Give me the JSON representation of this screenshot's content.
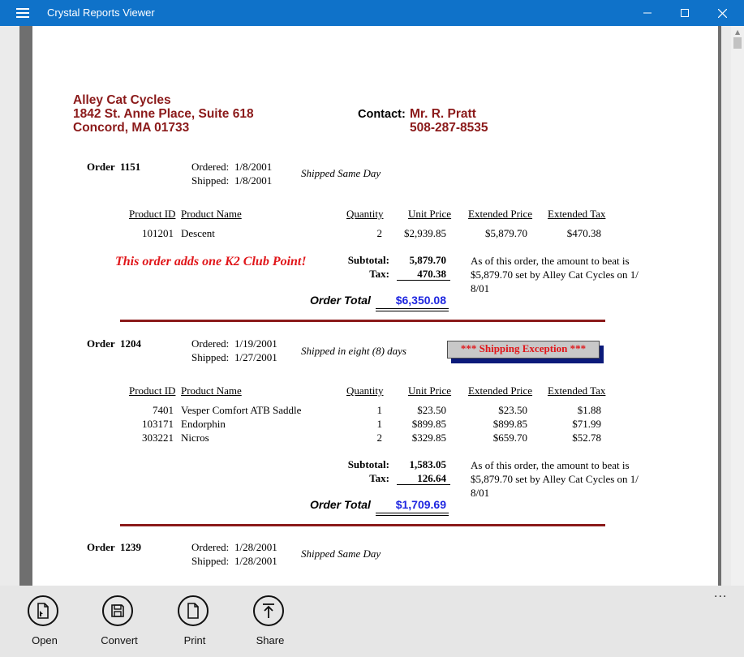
{
  "window": {
    "title": "Crystal Reports Viewer"
  },
  "company": {
    "name": "Alley Cat Cycles",
    "address1": "1842 St. Anne Place, Suite 618",
    "address2": "Concord, MA  01733",
    "contact_label": "Contact:",
    "contact_name": "Mr. R. Pratt",
    "contact_phone": "508-287-8535"
  },
  "labels": {
    "order": "Order",
    "ordered": "Ordered:",
    "shipped": "Shipped:",
    "product_id": "Product ID",
    "product_name": "Product Name",
    "quantity": "Quantity",
    "unit_price": "Unit Price",
    "extended_price": "Extended Price",
    "extended_tax": "Extended Tax",
    "subtotal": "Subtotal:",
    "tax": "Tax:",
    "order_total": "Order Total"
  },
  "orders": [
    {
      "id": "1151",
      "ordered": "1/8/2001",
      "shipped": "1/8/2001",
      "ship_note": "Shipped Same Day",
      "items": [
        {
          "pid": "101201",
          "name": "Descent",
          "qty": "2",
          "unit": "$2,939.85",
          "ext": "$5,879.70",
          "tax": "$470.38"
        }
      ],
      "promo": "This order adds one K2 Club Point!",
      "subtotal": "5,879.70",
      "tax": "470.38",
      "total": "$6,350.08",
      "note_l1": "As of this order, the amount to beat is",
      "note_l2": "$5,879.70 set by Alley Cat Cycles on 1/",
      "note_l3": "8/01"
    },
    {
      "id": "1204",
      "ordered": "1/19/2001",
      "shipped": "1/27/2001",
      "ship_note": "Shipped in eight (8) days",
      "exception": "*** Shipping Exception ***",
      "items": [
        {
          "pid": "7401",
          "name": "Vesper Comfort ATB Saddle",
          "qty": "1",
          "unit": "$23.50",
          "ext": "$23.50",
          "tax": "$1.88"
        },
        {
          "pid": "103171",
          "name": "Endorphin",
          "qty": "1",
          "unit": "$899.85",
          "ext": "$899.85",
          "tax": "$71.99"
        },
        {
          "pid": "303221",
          "name": "Nicros",
          "qty": "2",
          "unit": "$329.85",
          "ext": "$659.70",
          "tax": "$52.78"
        }
      ],
      "subtotal": "1,583.05",
      "tax": "126.64",
      "total": "$1,709.69",
      "note_l1": "As of this order, the amount to beat is",
      "note_l2": "$5,879.70 set by Alley Cat Cycles on 1/",
      "note_l3": "8/01"
    },
    {
      "id": "1239",
      "ordered": "1/28/2001",
      "shipped": "1/28/2001",
      "ship_note": "Shipped Same Day"
    }
  ],
  "toolbar": {
    "open": "Open",
    "convert": "Convert",
    "print": "Print",
    "share": "Share",
    "more": "..."
  }
}
